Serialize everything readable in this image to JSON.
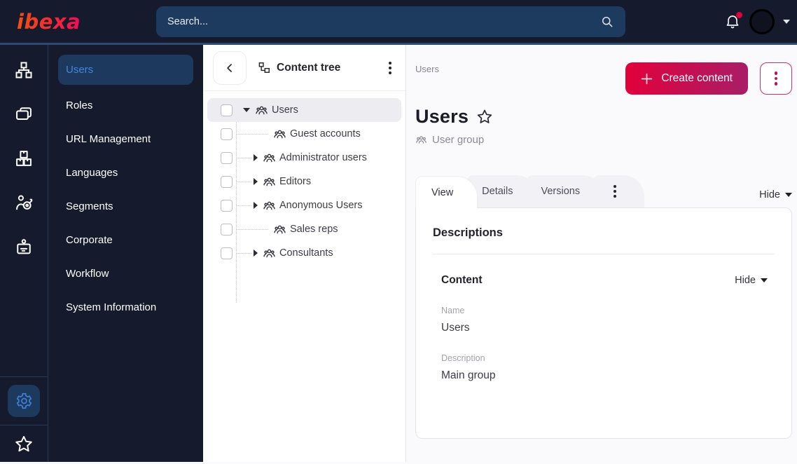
{
  "brand": {
    "name": "ibexa"
  },
  "topbar": {
    "search_placeholder": "Search..."
  },
  "sidebar": {
    "items": [
      {
        "label": "Users",
        "active": true
      },
      {
        "label": "Roles"
      },
      {
        "label": "URL Management"
      },
      {
        "label": "Languages"
      },
      {
        "label": "Segments"
      },
      {
        "label": "Corporate"
      },
      {
        "label": "Workflow"
      },
      {
        "label": "System Information"
      }
    ]
  },
  "content_tree": {
    "title": "Content tree",
    "items": [
      {
        "label": "Users",
        "expanded": true,
        "selected": true
      },
      {
        "label": "Guest accounts",
        "leaf": true
      },
      {
        "label": "Administrator users",
        "collapsed": true
      },
      {
        "label": "Editors",
        "collapsed": true
      },
      {
        "label": "Anonymous Users",
        "collapsed": true
      },
      {
        "label": "Sales reps",
        "leaf": true
      },
      {
        "label": "Consultants",
        "collapsed": true
      }
    ]
  },
  "main": {
    "breadcrumb": "Users",
    "create_button": "Create content",
    "title": "Users",
    "content_type": "User group",
    "tabs": [
      {
        "label": "View",
        "active": true
      },
      {
        "label": "Details"
      },
      {
        "label": "Versions"
      }
    ],
    "hide_label": "Hide",
    "card": {
      "heading": "Descriptions",
      "section": "Content",
      "hide_label": "Hide",
      "fields": [
        {
          "label": "Name",
          "value": "Users"
        },
        {
          "label": "Description",
          "value": "Main group"
        }
      ]
    }
  },
  "colors": {
    "topbar_bg": "#151a2c",
    "accent_gradient_start": "#e2013b",
    "accent_gradient_end": "#a81e67",
    "active_menu_bg": "#1d3a5e",
    "active_menu_text": "#4485e0",
    "notification_dot": "#e0003c"
  }
}
